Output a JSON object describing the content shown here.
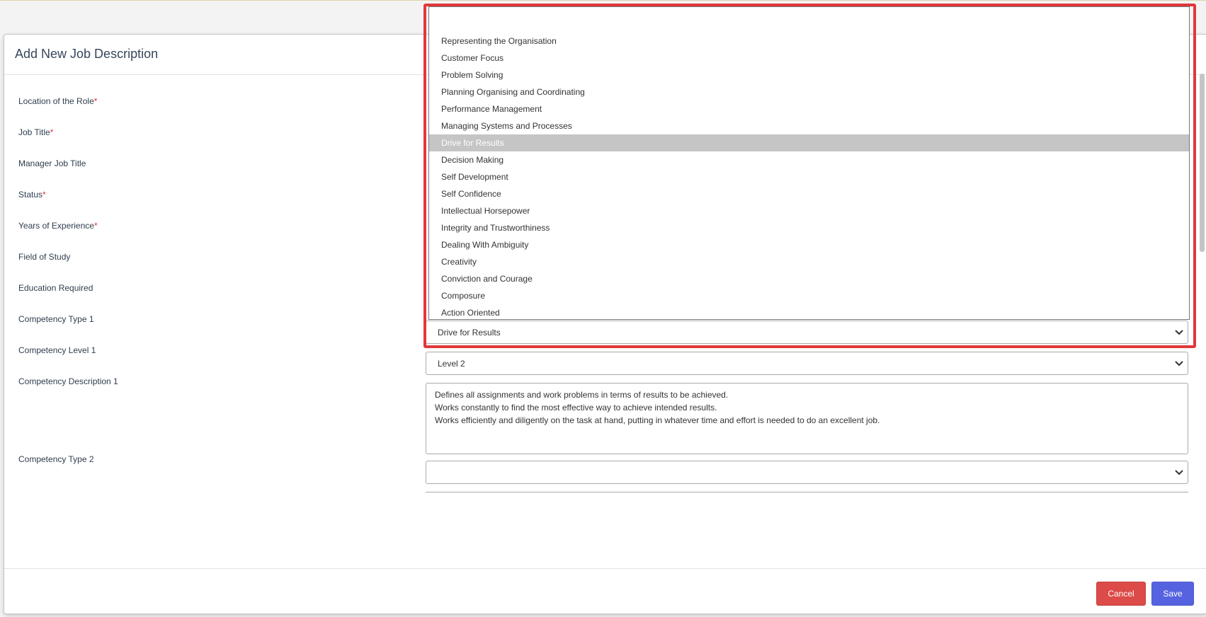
{
  "modal": {
    "title": "Add New Job Description",
    "cancel_label": "Cancel",
    "save_label": "Save"
  },
  "fields": {
    "location": {
      "label": "Location of the Role",
      "required_mark": "*"
    },
    "job_title": {
      "label": "Job Title",
      "required_mark": "*"
    },
    "manager_job_title": {
      "label": "Manager Job Title"
    },
    "status": {
      "label": "Status",
      "required_mark": "*"
    },
    "years_experience": {
      "label": "Years of Experience",
      "required_mark": "*"
    },
    "field_of_study": {
      "label": "Field of Study"
    },
    "education_required": {
      "label": "Education Required"
    },
    "competency_type_1": {
      "label": "Competency Type 1",
      "value": "Drive for Results"
    },
    "competency_level_1": {
      "label": "Competency Level 1",
      "value": "Level 2"
    },
    "competency_description_1": {
      "label": "Competency Description 1",
      "lines": [
        "Defines all assignments and work problems in terms of results to be achieved.",
        "Works constantly to find the most effective way to achieve intended results.",
        "Works efficiently and diligently on the task at hand, putting in whatever time and effort is needed to do an excellent job."
      ]
    },
    "competency_type_2": {
      "label": "Competency Type 2",
      "value": ""
    }
  },
  "dropdown": {
    "options": [
      "Representing the Organisation",
      "Customer Focus",
      "Problem Solving",
      "Planning Organising and Coordinating",
      "Performance Management",
      "Managing Systems and Processes",
      "Drive for Results",
      "Decision Making",
      "Self Development",
      "Self Confidence",
      "Intellectual Horsepower",
      "Integrity and Trustworthiness",
      "Dealing With Ambiguity",
      "Creativity",
      "Conviction and Courage",
      "Composure",
      "Action Oriented"
    ],
    "selected": "Drive for Results"
  },
  "colors": {
    "cancel": "#dc4b48",
    "save": "#5663e0",
    "highlight": "#e0383c",
    "selected_option": "#c5c5c5"
  }
}
